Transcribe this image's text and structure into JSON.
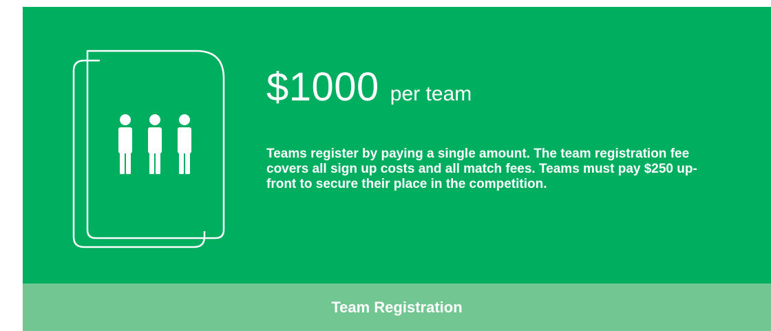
{
  "colors": {
    "background": "#00AE5F",
    "button": "#72C691",
    "text": "#FFFFFF"
  },
  "icon": "team-document-icon",
  "pricing": {
    "amount": "$1000",
    "unit": "per team",
    "description": "Teams register by paying a single amount. The team registration fee covers all sign up costs and all match fees. Teams must pay $250 up-front to secure their place in the competition."
  },
  "action": {
    "label": "Team Registration"
  }
}
